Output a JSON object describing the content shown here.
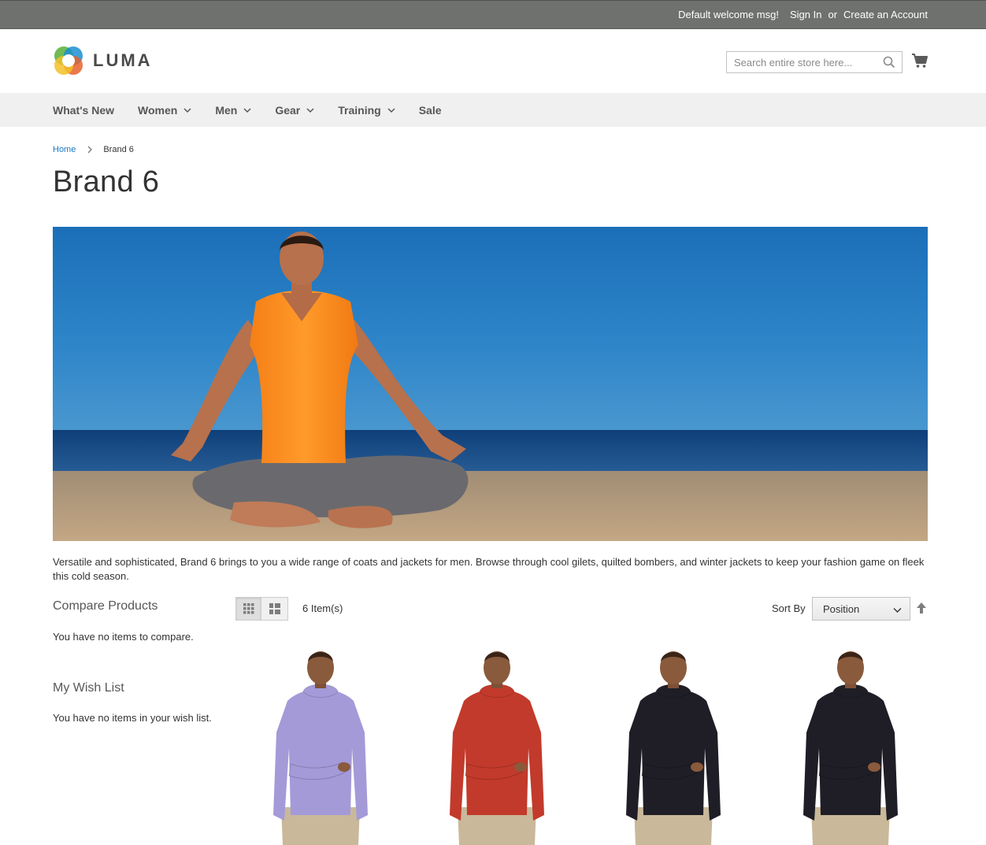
{
  "topbar": {
    "welcome": "Default welcome msg!",
    "sign_in": "Sign In",
    "or": "or",
    "create_account": "Create an Account"
  },
  "header": {
    "logo_text": "LUMA",
    "search_placeholder": "Search entire store here...",
    "icons": {
      "search": "search-icon",
      "cart": "cart-icon"
    }
  },
  "nav": {
    "items": [
      {
        "label": "What's New",
        "has_dropdown": false
      },
      {
        "label": "Women",
        "has_dropdown": true
      },
      {
        "label": "Men",
        "has_dropdown": true
      },
      {
        "label": "Gear",
        "has_dropdown": true
      },
      {
        "label": "Training",
        "has_dropdown": true
      },
      {
        "label": "Sale",
        "has_dropdown": false
      }
    ]
  },
  "breadcrumb": {
    "home": "Home",
    "current": "Brand 6"
  },
  "page": {
    "title": "Brand 6",
    "description": "Versatile and sophisticated, Brand 6 brings to you a wide range of coats and jackets for men. Browse through cool gilets, quilted bombers, and winter jackets to keep your fashion game on fleek this cold season."
  },
  "sidebar": {
    "compare_title": "Compare Products",
    "compare_empty": "You have no items to compare.",
    "wishlist_title": "My Wish List",
    "wishlist_empty": "You have no items in your wish list."
  },
  "toolbar": {
    "count": "6 Item(s)",
    "sort_label": "Sort By",
    "sort_value": "Position",
    "view_modes": [
      "grid",
      "list"
    ],
    "active_mode": "grid"
  },
  "products": [
    {
      "hoodie_color": "#a49ad8"
    },
    {
      "hoodie_color": "#c23a2b"
    },
    {
      "hoodie_color": "#1f1d26"
    },
    {
      "hoodie_color": "#1f1d26"
    }
  ],
  "colors": {
    "topbar_bg": "#6e716e",
    "nav_bg": "#f0f0f0",
    "link": "#1979c3"
  }
}
